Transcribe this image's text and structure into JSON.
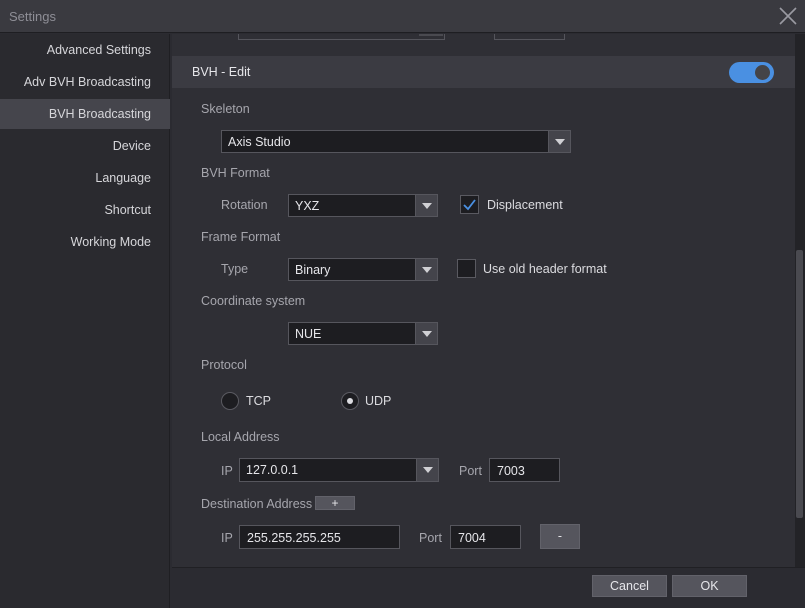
{
  "window": {
    "title": "Settings"
  },
  "sidebar": {
    "items": [
      {
        "label": "Advanced Settings"
      },
      {
        "label": "Adv BVH Broadcasting"
      },
      {
        "label": "BVH Broadcasting",
        "active": true
      },
      {
        "label": "Device"
      },
      {
        "label": "Language"
      },
      {
        "label": "Shortcut"
      },
      {
        "label": "Working Mode"
      }
    ]
  },
  "section": {
    "title": "BVH - Edit",
    "enabled": true
  },
  "skeleton": {
    "label": "Skeleton",
    "value": "Axis Studio"
  },
  "bvh_format": {
    "label": "BVH Format",
    "rotation_label": "Rotation",
    "rotation_value": "YXZ",
    "displacement_label": "Displacement",
    "displacement_checked": true
  },
  "frame_format": {
    "label": "Frame Format",
    "type_label": "Type",
    "type_value": "Binary",
    "old_header_label": "Use old header format",
    "old_header_checked": false
  },
  "coordinate": {
    "label": "Coordinate system",
    "value": "NUE"
  },
  "protocol": {
    "label": "Protocol",
    "tcp_label": "TCP",
    "udp_label": "UDP",
    "selected": "UDP"
  },
  "local_address": {
    "label": "Local Address",
    "ip_label": "IP",
    "ip_value": "127.0.0.1",
    "port_label": "Port",
    "port_value": "7003"
  },
  "destination_address": {
    "label": "Destination Address",
    "add_label": "+",
    "ip_label": "IP",
    "ip_value": "255.255.255.255",
    "port_label": "Port",
    "port_value": "7004",
    "remove_label": "-"
  },
  "footer": {
    "cancel_label": "Cancel",
    "ok_label": "OK"
  },
  "colors": {
    "accent": "#4a90e2",
    "background": "#2f2f35",
    "sidebar_active": "#45454c"
  }
}
